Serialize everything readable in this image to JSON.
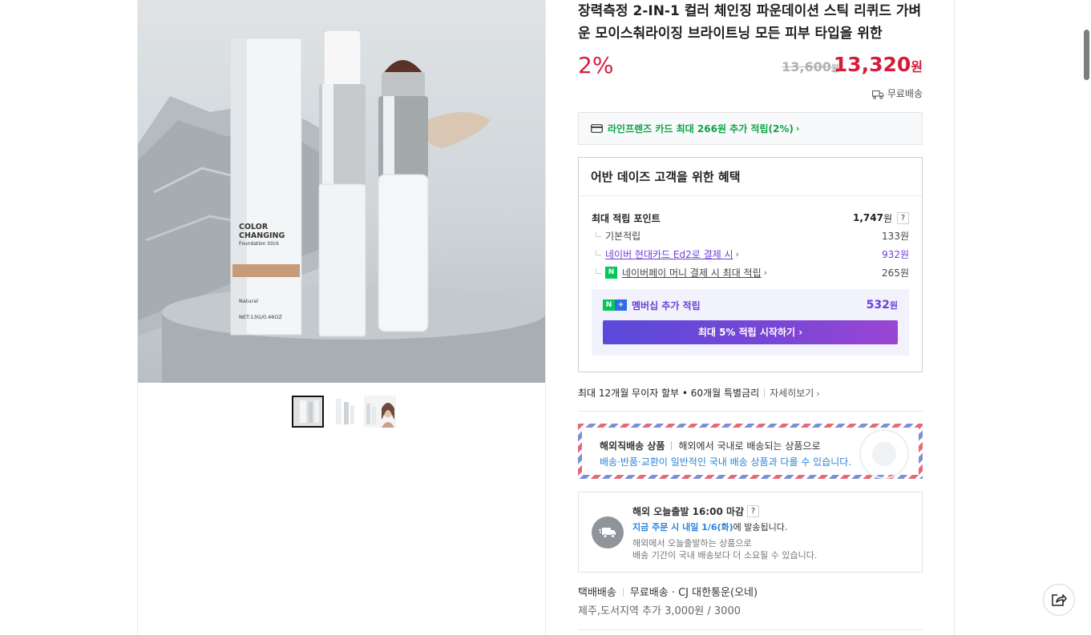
{
  "product": {
    "title": "장력측정 2-IN-1 컬러 체인징 파운데이션 스틱 리퀴드 가벼운 모이스춰라이징 브라이트닝 모든 피부 타입을 위한",
    "discount": "2%",
    "original_price": "13,600",
    "original_unit": "원",
    "sale_price": "13,320",
    "sale_unit": "원",
    "delivery": "무료배송"
  },
  "gallery": {
    "image_text": {
      "brand_line1": "COLOR",
      "brand_line2": "CHANGING",
      "brand_line3": "Foundation Stick",
      "shade": "Natural",
      "net": "NET:13G/0.46OZ"
    },
    "thumbnail_count": 3,
    "active_thumbnail": 1
  },
  "card_banner": {
    "text": "라인프렌즈 카드 최대 266원 추가 적립(2%)"
  },
  "benefits": {
    "heading": "어반 데이즈 고객을 위한 혜택",
    "max_points_label": "최대 적립 포인트",
    "max_points_value": "1,747",
    "unit": "원",
    "help": "?",
    "basic_label": "기본적립",
    "basic_value": "133원",
    "hyundai_label": "네이버 현대카드 Ed2로 결제 시",
    "hyundai_value": "932원",
    "npay_badge": "N",
    "npay_label": "네이버페이 머니 결제 시 최대 적립",
    "npay_value": "265원",
    "member_label": "멤버십 추가 적립",
    "member_value": "532",
    "member_unit": "원",
    "start_button": "최대 5% 적립 시작하기"
  },
  "installment": {
    "text": "최대 12개월 무이자 할부 • 60개월 특별금리",
    "more": "자세히보기"
  },
  "overseas": {
    "title": "해외직배송 상품",
    "desc": "해외에서 국내로 배송되는 상품으로",
    "note": "배송·반품·교환이 일반적인 국내 배송 상품과 다를 수 있습니다."
  },
  "today": {
    "title": "해외 오늘출발 16:00 마감",
    "help": "?",
    "order_highlight": "지금 주문 시 내일 1/6(화)",
    "order_suffix": "에 발송됩니다.",
    "note1": "해외에서 오늘출발하는 상품으로",
    "note2": "배송 기간이 국내 배송보다 더 소요될 수 있습니다."
  },
  "shipping": {
    "type": "택배배송",
    "fee": "무료배송",
    "dot": "·",
    "carrier": "CJ 대한통운(오네)",
    "extra": "제주,도서지역 추가 3,000원 / 3000"
  },
  "colors": {
    "accent_red": "#d51c3a",
    "naver_green": "#03c75a",
    "membership_purple": "#6c3fd9",
    "info_blue": "#2a83d9"
  }
}
